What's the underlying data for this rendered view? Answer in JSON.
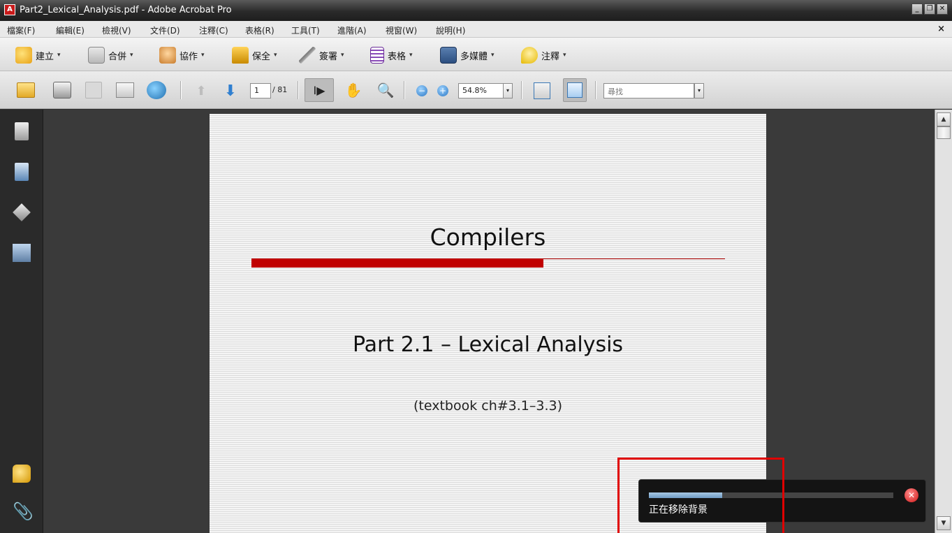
{
  "window": {
    "title": "Part2_Lexical_Analysis.pdf - Adobe Acrobat Pro",
    "minimize_icon": "minimize-icon",
    "restore_icon": "restore-icon",
    "close_icon": "close-icon"
  },
  "menubar": {
    "items": [
      "檔案(F)",
      "編輯(E)",
      "檢視(V)",
      "文件(D)",
      "注釋(C)",
      "表格(R)",
      "工具(T)",
      "進階(A)",
      "視窗(W)",
      "說明(H)"
    ],
    "close_label": "×"
  },
  "tasks": {
    "items": [
      {
        "label": "建立",
        "icon": "create-icon"
      },
      {
        "label": "合併",
        "icon": "combine-icon"
      },
      {
        "label": "協作",
        "icon": "collaborate-icon"
      },
      {
        "label": "保全",
        "icon": "secure-lock-icon"
      },
      {
        "label": "簽署",
        "icon": "sign-pen-icon"
      },
      {
        "label": "表格",
        "icon": "forms-icon"
      },
      {
        "label": "多媒體",
        "icon": "multimedia-icon"
      },
      {
        "label": "注釋",
        "icon": "comment-icon"
      }
    ],
    "caret": "▾"
  },
  "navbar": {
    "current_page": "1",
    "page_total": "/ 81",
    "zoom": "54.8%",
    "search_placeholder": "尋找",
    "dropdown_caret": "▾"
  },
  "document": {
    "title": "Compilers",
    "subtitle": "Part 2.1 – Lexical Analysis",
    "note": "(textbook ch#3.1–3.3)"
  },
  "toast": {
    "message": "正在移除背景",
    "progress": 0.3,
    "close_label": "✕"
  },
  "scrollbar": {
    "up": "▲",
    "down": "▼"
  },
  "colors": {
    "accent_red": "#c00000",
    "progress_blue": "#6f9bc4",
    "highlight_red": "#e00000"
  }
}
